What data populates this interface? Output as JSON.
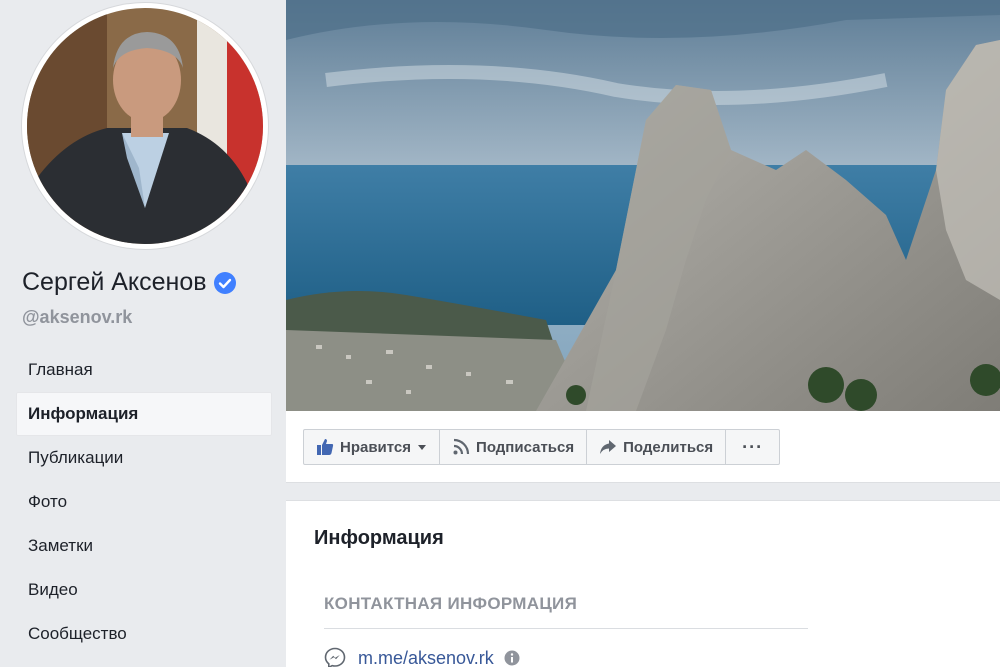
{
  "profile": {
    "name": "Сергей Аксенов",
    "handle": "@aksenov.rk"
  },
  "nav": {
    "items": [
      {
        "label": "Главная"
      },
      {
        "label": "Информация"
      },
      {
        "label": "Публикации"
      },
      {
        "label": "Фото"
      },
      {
        "label": "Заметки"
      },
      {
        "label": "Видео"
      },
      {
        "label": "Сообщество"
      }
    ],
    "active": "Информация"
  },
  "actions": {
    "like": "Нравится",
    "follow": "Подписаться",
    "share": "Поделиться",
    "more": "···"
  },
  "info": {
    "title": "Информация",
    "contact_header": "КОНТАКТНАЯ ИНФОРМАЦИЯ",
    "messenger_link": "m.me/aksenov.rk"
  },
  "colors": {
    "accent": "#4267b2",
    "link": "#385898",
    "verified": "#4080ff",
    "page_bg": "#e9ebee"
  },
  "icons": [
    "verified-badge-icon",
    "thumbs-up-icon",
    "caret-down-icon",
    "rss-icon",
    "share-arrow-icon",
    "messenger-icon",
    "info-icon"
  ]
}
